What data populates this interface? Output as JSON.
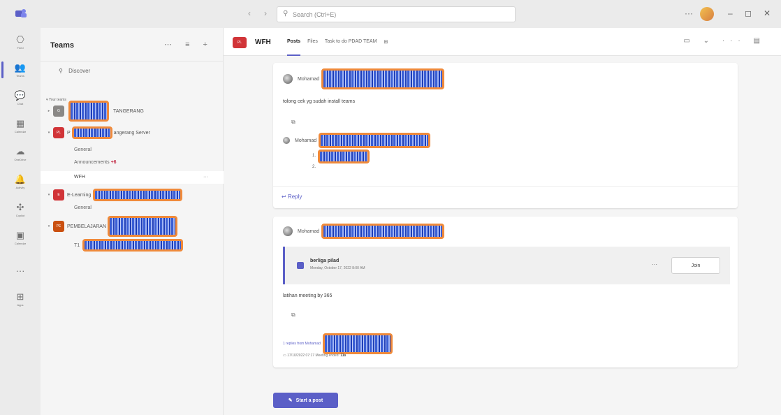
{
  "titlebar": {
    "search_placeholder": "Search (Ctrl+E)",
    "back_glyph": "‹",
    "forward_glyph": "›",
    "more_glyph": "···",
    "minimize_glyph": "–",
    "maximize_glyph": "◻",
    "close_glyph": "✕"
  },
  "rail": {
    "items": [
      {
        "label": "Feed",
        "icon": "feed-icon",
        "glyph": "⎔"
      },
      {
        "label": "Teams",
        "icon": "teams-icon",
        "glyph": "👥"
      },
      {
        "label": "Chat",
        "icon": "chat-icon",
        "glyph": "💬"
      },
      {
        "label": "Calendar",
        "icon": "calendar-icon",
        "glyph": "▦"
      },
      {
        "label": "OneDrive",
        "icon": "cloud-icon",
        "glyph": "☁"
      },
      {
        "label": "Activity",
        "icon": "bell-icon",
        "glyph": "🔔"
      },
      {
        "label": "Copilot",
        "icon": "copilot-icon",
        "glyph": "✣"
      },
      {
        "label": "Calendar",
        "icon": "calendar-grid-icon",
        "glyph": "▣"
      },
      {
        "label": "",
        "icon": "more-icon",
        "glyph": "···"
      },
      {
        "label": "Apps",
        "icon": "apps-icon",
        "glyph": "⊞"
      }
    ]
  },
  "teams_panel": {
    "title": "Teams",
    "actions": "⋯ ≡ +",
    "discover_icon": "⚲",
    "discover": "Discover",
    "group_label": "Your teams",
    "teams": [
      {
        "avatar": "G",
        "avatar_color": "#8a8886",
        "suffix": "TANGERANG"
      },
      {
        "avatar": "PL",
        "avatar_color": "#d13438",
        "prefix": "P",
        "suffix": "angerang Server"
      },
      {
        "avatar": "E",
        "avatar_color": "#d13438",
        "prefix": "E-Learning"
      },
      {
        "avatar": "PE",
        "avatar_color": "#ca5010",
        "prefix": "PEMBELAJARAN"
      }
    ],
    "channels": {
      "general": "General",
      "announcements": "Announcements",
      "announcements_badge": "+6",
      "wfh": "WFH",
      "wfh_more": "···",
      "general2": "General",
      "t1": "T1"
    }
  },
  "channel": {
    "avatar": "PL",
    "title": "WFH",
    "tabs": [
      "Posts",
      "Files",
      "Task to do PDAD TEAM",
      "⊞"
    ],
    "right_controls": "▭ ⌄ ··· ▤"
  },
  "posts": [
    {
      "author": "Mohamad",
      "message": "tolong cek yg sudah install teams",
      "attachment_icon": "⧉",
      "reply_author": "Mohamad",
      "list_1": "1.",
      "list_2": "2.",
      "reply_icon": "↩",
      "reply_label": "Reply"
    },
    {
      "author": "Mohamad",
      "meeting_title": "berliga pilad",
      "meeting_date": "Monday, October 17, 2022 8:00 AM",
      "meeting_more": "···",
      "join_label": "Join",
      "message": "latihan meeting by 365",
      "attachment_icon": "⧉",
      "replies_link": "1 replies from Mohamad",
      "ended_icon": "▭",
      "ended_time": "17/10/2022 07:17",
      "ended_text": "Meeting ended:",
      "ended_duration": "11s"
    }
  ],
  "start_post": "Start a post",
  "start_post_icon": "✎"
}
